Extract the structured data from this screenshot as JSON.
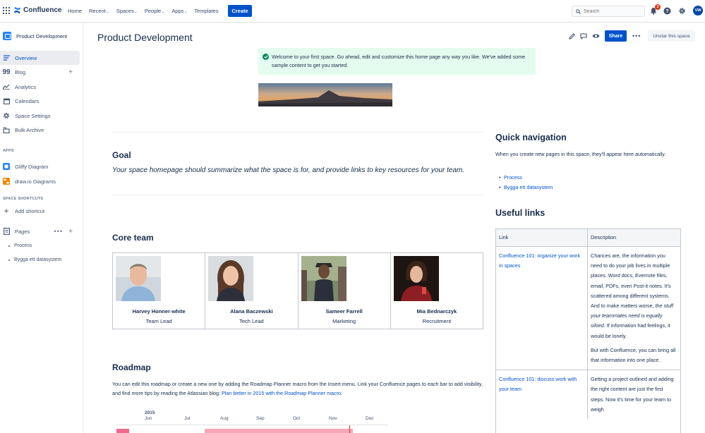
{
  "topbar": {
    "app_name": "Confluence",
    "nav": [
      {
        "label": "Home",
        "dropdown": false
      },
      {
        "label": "Recent",
        "dropdown": true
      },
      {
        "label": "Spaces",
        "dropdown": true
      },
      {
        "label": "People",
        "dropdown": true
      },
      {
        "label": "Apps",
        "dropdown": true
      },
      {
        "label": "Templates",
        "dropdown": false
      }
    ],
    "create_label": "Create",
    "search_placeholder": "Search",
    "notification_count": "3",
    "avatar_initials": "VW",
    "brand_color": "#0052cc"
  },
  "sidebar": {
    "space_name": "Product Development",
    "items": [
      {
        "label": "Overview",
        "icon": "lines-icon",
        "active": true
      },
      {
        "label": "Blog",
        "icon": "quote-icon"
      },
      {
        "label": "Analytics",
        "icon": "chart-line-icon"
      },
      {
        "label": "Calendars",
        "icon": "calendar-icon"
      },
      {
        "label": "Space Settings",
        "icon": "gear-icon"
      },
      {
        "label": "Bulk Archive",
        "icon": "archive-icon"
      }
    ],
    "apps_heading": "APPS",
    "apps": [
      {
        "label": "Gliffy Diagram",
        "icon": "gliffy-icon"
      },
      {
        "label": "draw.io Diagrams",
        "icon": "drawio-icon"
      }
    ],
    "shortcuts_heading": "SPACE SHORTCUTS",
    "add_shortcut_label": "Add shortcut",
    "pages_label": "Pages",
    "pages": [
      "Process",
      "Bygga ett datasystem"
    ]
  },
  "page": {
    "title": "Product Development",
    "share_label": "Share",
    "unstar_label": "Unstar this space",
    "info_text": "Welcome to your first space. Go ahead, edit and customize this home page any way you like. We've added some sample content to get you started.",
    "goal_heading": "Goal",
    "goal_text": "Your space homepage should summarize what the space is for, and provide links to key resources for your team.",
    "core_team_heading": "Core team",
    "team": [
      {
        "name": "Harvey Honner-white",
        "role": "Team Lead"
      },
      {
        "name": "Alana Baczewski",
        "role": "Tech Lead"
      },
      {
        "name": "Sameer Farrell",
        "role": "Marketing"
      },
      {
        "name": "Mia Bednarczyk",
        "role": "Recruitment"
      }
    ],
    "roadmap_heading": "Roadmap",
    "roadmap_text": "You can edit this roadmap or create a new one by adding the Roadmap Planner macro from the Insert menu. Link your Confluence pages to each bar to add visibility, and find more tips by reading the Atlassian blog: ",
    "roadmap_link": "Plan better in 2015 with the Roadmap Planner macro.",
    "roadmap_year": "2015",
    "roadmap_months": [
      "Jun",
      "Jul",
      "Aug",
      "Sep",
      "Oct",
      "Nov",
      "Dec"
    ],
    "quick_nav_heading": "Quick navigation",
    "quick_nav_text": "When you create new pages in this space, they'll appear here automatically.",
    "quick_nav_links": [
      "Process",
      "Bygga ett datasystem"
    ],
    "useful_links_heading": "Useful links",
    "links_table": {
      "headers": [
        "Link",
        "Description"
      ],
      "rows": [
        {
          "link": "Confluence 101: organize your work in spaces",
          "desc_1": "Chances are, the information you need to do your job lives in multiple places. Word docs, Evernote files, email, PDFs, even Post-it notes. It's scattered among different systems. And to make matters worse, ",
          "desc_italic": "the stuff your teammates need is equally siloed",
          "desc_2": ". If information had feelings, it would be lonely.",
          "desc_3": "But with Confluence, you can bring all that information into one place."
        },
        {
          "link": "Confluence 101: discuss work with your team",
          "desc_1": "Getting a project outlined and adding the right content are just the first steps. Now it's time for your team to weigh"
        }
      ]
    }
  }
}
